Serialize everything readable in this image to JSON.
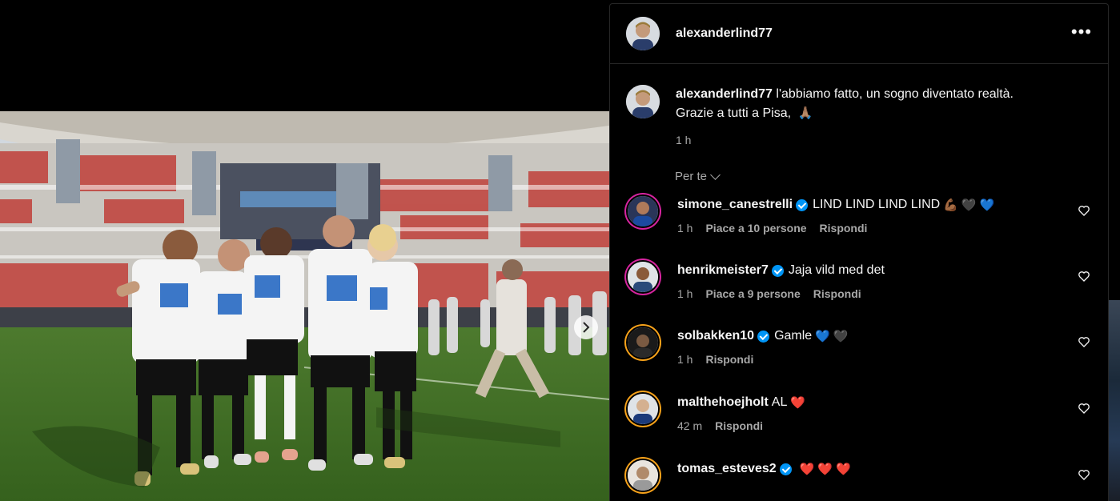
{
  "post": {
    "author": "alexanderlind77",
    "caption_user": "alexanderlind77",
    "caption_line1": "l'abbiamo fatto, un sogno diventato realtà.",
    "caption_line2": "Grazie a tutti a Pisa,",
    "caption_emoji": "🙏🏽",
    "time": "1 h",
    "more_label": "•••"
  },
  "comments_filter": "Per te",
  "comments": [
    {
      "user": "simone_canestrelli",
      "verified": true,
      "text": "LIND LIND LIND LIND",
      "emojis": [
        "💪🏾",
        "🖤",
        "💙"
      ],
      "time": "1 h",
      "likes": "Piace a 10 persone",
      "reply": "Rispondi"
    },
    {
      "user": "henrikmeister7",
      "verified": true,
      "text": "Jaja vild med det",
      "emojis": [],
      "time": "1 h",
      "likes": "Piace a 9 persone",
      "reply": "Rispondi"
    },
    {
      "user": "solbakken10",
      "verified": true,
      "text": "Gamle",
      "emojis": [
        "💙",
        "🖤"
      ],
      "time": "1 h",
      "likes": "",
      "reply": "Rispondi"
    },
    {
      "user": "malthehoejholt",
      "verified": false,
      "text": "AL",
      "emojis": [
        "❤️"
      ],
      "time": "42 m",
      "likes": "",
      "reply": "Rispondi"
    },
    {
      "user": "tomas_esteves2",
      "verified": true,
      "text": "",
      "emojis": [
        "❤️",
        "❤️",
        "❤️"
      ],
      "time": "",
      "likes": "",
      "reply": ""
    }
  ],
  "colors": {
    "verified": "#0095f6",
    "secondary_text": "#a8a8a8",
    "story_ring": "#d6249f"
  }
}
